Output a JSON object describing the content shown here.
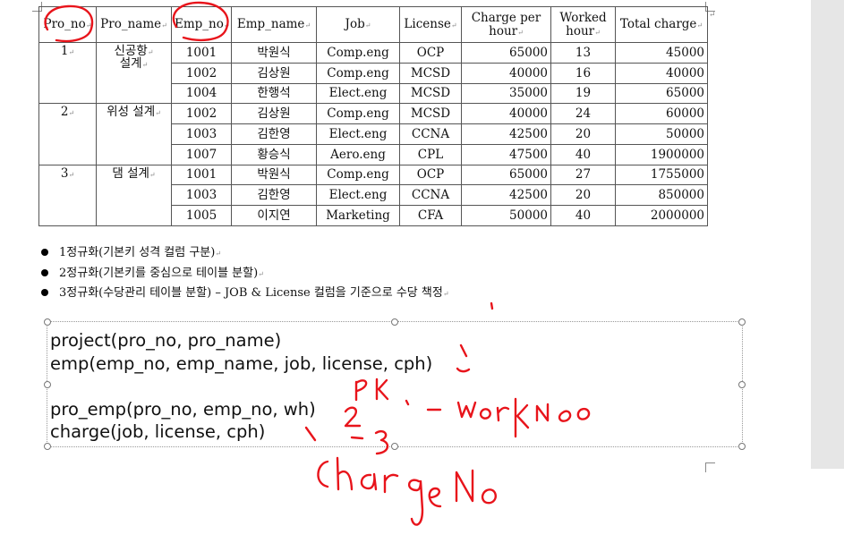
{
  "table": {
    "headers": {
      "pro_no": "Pro_no",
      "pro_name": "Pro_name",
      "emp_no": "Emp_no",
      "emp_name": "Emp_name",
      "job": "Job",
      "license": "License",
      "charge_per_hour_1": "Charge per",
      "charge_per_hour_2": "hour",
      "worked_hour_1": "Worked",
      "worked_hour_2": "hour",
      "total_charge": "Total charge"
    },
    "projects": [
      {
        "no": "1",
        "name_1": "신공항",
        "name_2": "설계"
      },
      {
        "no": "2",
        "name_1": "위성 설계",
        "name_2": ""
      },
      {
        "no": "3",
        "name_1": "댐 설계",
        "name_2": ""
      }
    ],
    "rows": [
      {
        "emp_no": "1001",
        "emp_name": "박원식",
        "job": "Comp.eng",
        "license": "OCP",
        "cph": "65000",
        "wh": "13",
        "total": "45000"
      },
      {
        "emp_no": "1002",
        "emp_name": "김상원",
        "job": "Comp.eng",
        "license": "MCSD",
        "cph": "40000",
        "wh": "16",
        "total": "40000"
      },
      {
        "emp_no": "1004",
        "emp_name": "한행석",
        "job": "Elect.eng",
        "license": "MCSD",
        "cph": "35000",
        "wh": "19",
        "total": "65000"
      },
      {
        "emp_no": "1002",
        "emp_name": "김상원",
        "job": "Comp.eng",
        "license": "MCSD",
        "cph": "40000",
        "wh": "24",
        "total": "60000"
      },
      {
        "emp_no": "1003",
        "emp_name": "김한영",
        "job": "Elect.eng",
        "license": "CCNA",
        "cph": "42500",
        "wh": "20",
        "total": "50000"
      },
      {
        "emp_no": "1007",
        "emp_name": "황승식",
        "job": "Aero.eng",
        "license": "CPL",
        "cph": "47500",
        "wh": "40",
        "total": "1900000"
      },
      {
        "emp_no": "1001",
        "emp_name": "박원식",
        "job": "Comp.eng",
        "license": "OCP",
        "cph": "65000",
        "wh": "27",
        "total": "1755000"
      },
      {
        "emp_no": "1003",
        "emp_name": "김한영",
        "job": "Elect.eng",
        "license": "CCNA",
        "cph": "42500",
        "wh": "20",
        "total": "850000"
      },
      {
        "emp_no": "1005",
        "emp_name": "이지연",
        "job": "Marketing",
        "license": "CFA",
        "cph": "50000",
        "wh": "40",
        "total": "2000000"
      }
    ]
  },
  "bullets": [
    "1정규화(기본키 성격 컬럼 구분)",
    "2정규화(기본키를 중심으로 테이블 분할)",
    "3정규화(수당관리 테이블 분할) – JOB & License 컬럼을 기준으로 수당 책정"
  ],
  "code_lines": [
    "project(pro_no, pro_name)",
    "emp(emp_no, emp_name, job, license, cph)",
    "",
    "pro_emp(pro_no, emp_no, wh)",
    "charge(job, license, cph)"
  ],
  "annotation_color": "#e8141b",
  "mark_color": "#888888"
}
